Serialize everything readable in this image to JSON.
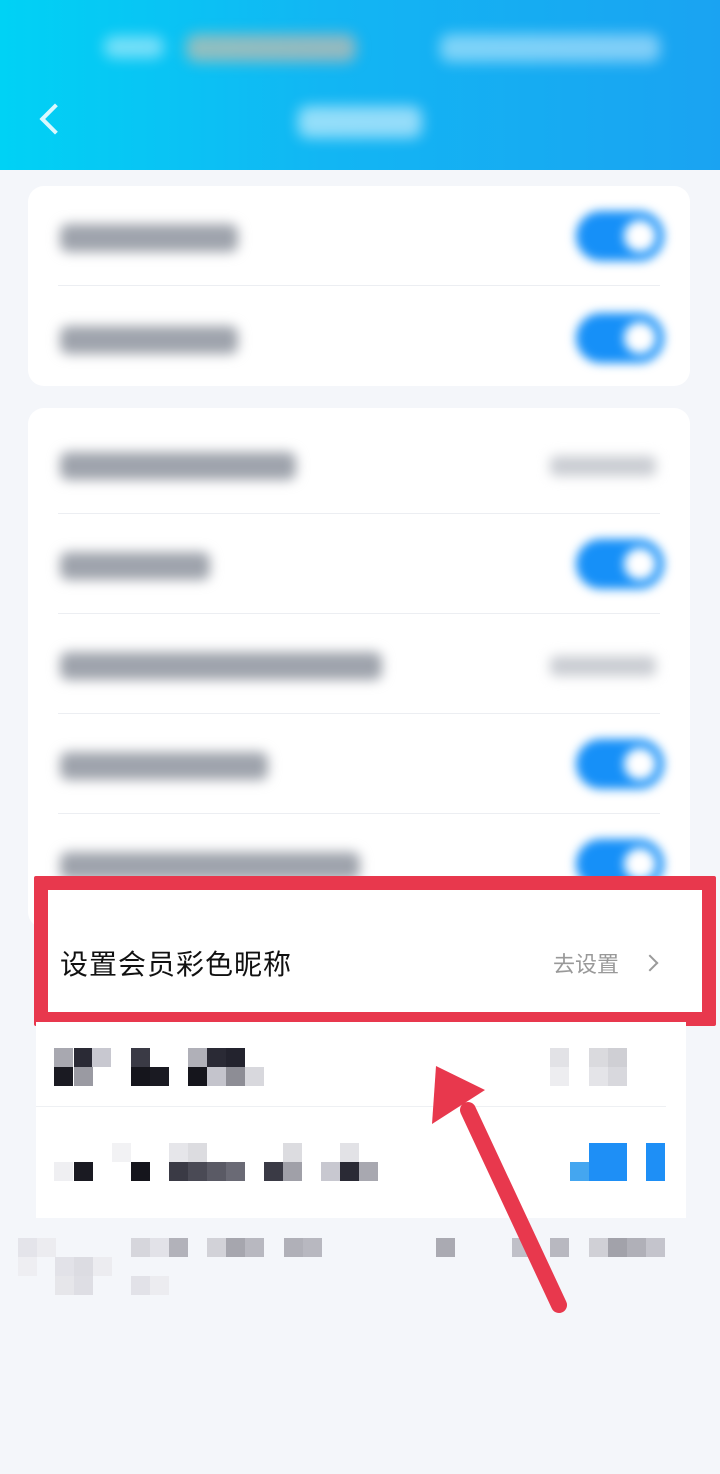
{
  "settings": {
    "highlighted_row": {
      "title": "设置会员彩色昵称",
      "action": "去设置"
    }
  },
  "colors": {
    "header_gradient_start": "#00d2f5",
    "header_gradient_end": "#1aa3f2",
    "toggle_on": "#1690f8",
    "annotation_red": "#e8384d",
    "page_background": "#f4f6fa"
  },
  "icons": {
    "back": "chevron-left-icon",
    "row_arrow": "chevron-right-icon",
    "annotation": "red-arrow-icon"
  }
}
